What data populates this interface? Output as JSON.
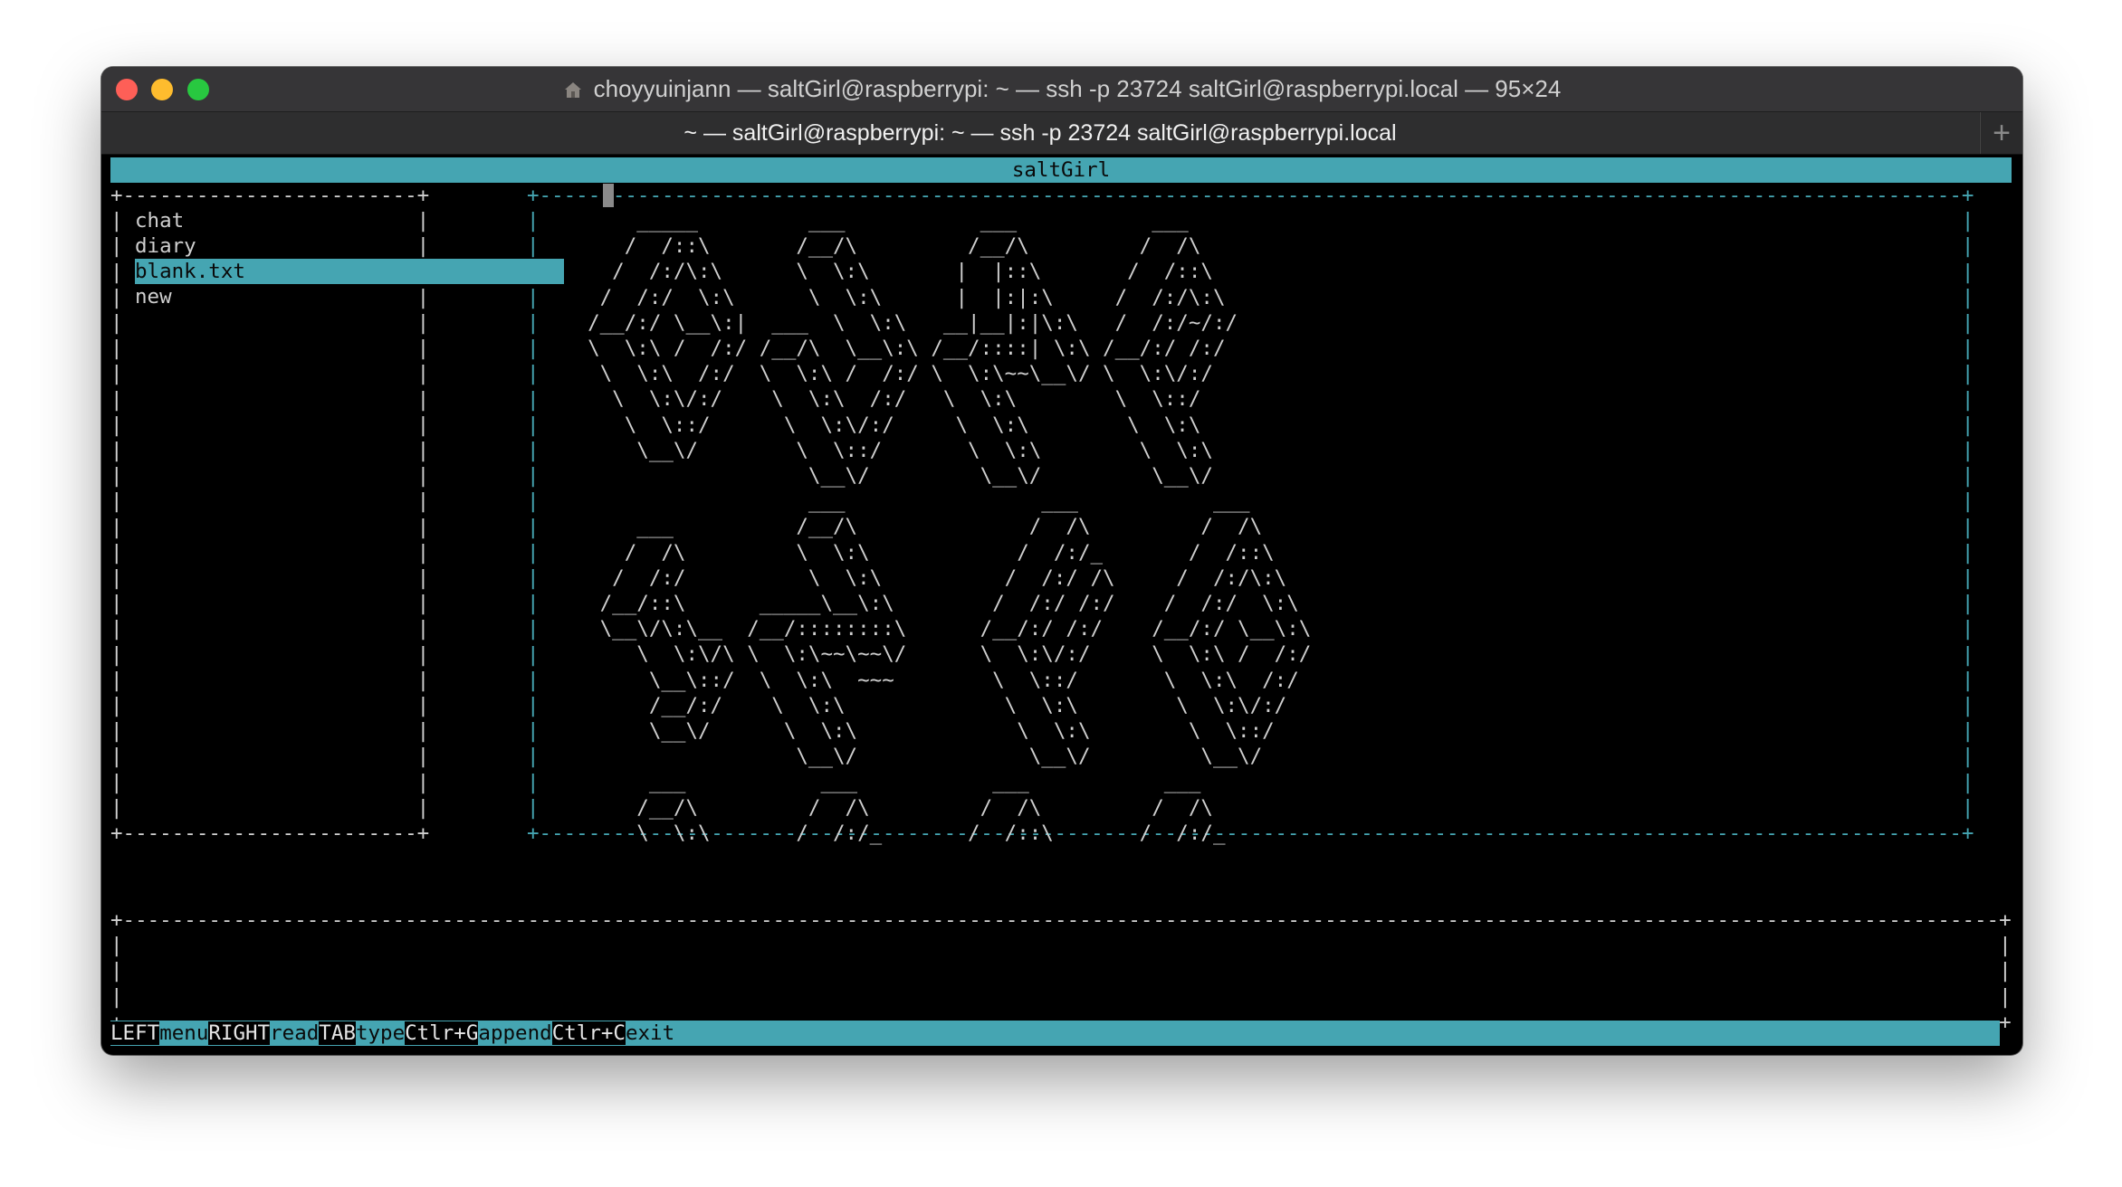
{
  "window": {
    "title": "choyyuinjann — saltGirl@raspberrypi: ~ — ssh -p 23724 saltGirl@raspberrypi.local — 95×24",
    "tab_label": "~ — saltGirl@raspberrypi: ~ — ssh -p 23724 saltGirl@raspberrypi.local",
    "new_tab_label": "+"
  },
  "terminal": {
    "header_title": "saltGirl",
    "menu_items": [
      {
        "label": "chat",
        "selected": false
      },
      {
        "label": "diary",
        "selected": false
      },
      {
        "label": "blank.txt",
        "selected": true
      },
      {
        "label": "new",
        "selected": false
      }
    ],
    "ascii_art": [
      "      _____         ___           ___           ___",
      "     /  /::\\       /__/\\         /__/\\         /  /\\",
      "    /  /:/\\:\\      \\  \\:\\       |  |::\\       /  /::\\",
      "   /  /:/  \\:\\      \\  \\:\\      |  |:|:\\     /  /:/\\:\\",
      "  /__/:/ \\__\\:|  ___  \\  \\:\\   __|__|:|\\:\\   /  /:/~/:/",
      "  \\  \\:\\ /  /:/ /__/\\  \\__\\:\\ /__/::::| \\:\\ /__/:/ /:/",
      "   \\  \\:\\  /:/  \\  \\:\\ /  /:/ \\  \\:\\~~\\__\\/ \\  \\:\\/:/",
      "    \\  \\:\\/:/    \\  \\:\\  /:/   \\  \\:\\        \\  \\::/",
      "     \\  \\::/      \\  \\:\\/:/     \\  \\:\\        \\  \\:\\",
      "      \\__\\/        \\  \\::/       \\  \\:\\        \\  \\:\\",
      "                    \\__\\/         \\__\\/         \\__\\/",
      "                    ___                ___           ___",
      "      ___          /__/\\              /  /\\         /  /\\",
      "     /  /\\         \\  \\:\\            /  /:/_       /  /::\\",
      "    /  /:/          \\  \\:\\          /  /:/ /\\     /  /:/\\:\\",
      "   /__/::\\      _____\\__\\:\\        /  /:/ /:/    /  /:/  \\:\\",
      "   \\__\\/\\:\\__  /__/::::::::\\      /__/:/ /:/    /__/:/ \\__\\:\\",
      "      \\  \\:\\/\\ \\  \\:\\~~\\~~\\/      \\  \\:\\/:/     \\  \\:\\ /  /:/",
      "       \\__\\::/  \\  \\:\\  ~~~        \\  \\::/       \\  \\:\\  /:/",
      "       /__/:/    \\  \\:\\             \\  \\:\\        \\  \\:\\/:/",
      "       \\__\\/      \\  \\:\\             \\  \\:\\        \\  \\::/",
      "                   \\__\\/              \\__\\/         \\__\\/",
      "       ___           ___           ___           ___",
      "      /__/\\         /  /\\         /  /\\         /  /\\",
      "      \\  \\:\\       /  /:/_       /  /::\\       /  /:/_"
    ],
    "status_bar": [
      {
        "key": "LEFT",
        "action": "menu"
      },
      {
        "key": "RIGHT",
        "action": "read"
      },
      {
        "key": "TAB",
        "action": "type"
      },
      {
        "key": "Ctlr+G",
        "action": "append"
      },
      {
        "key": "Ctlr+C",
        "action": "exit"
      }
    ]
  },
  "colors": {
    "accent": "#45a5b2",
    "terminal_bg": "#000000",
    "terminal_fg": "#cfcfcf",
    "titlebar_bg": "#363537"
  }
}
